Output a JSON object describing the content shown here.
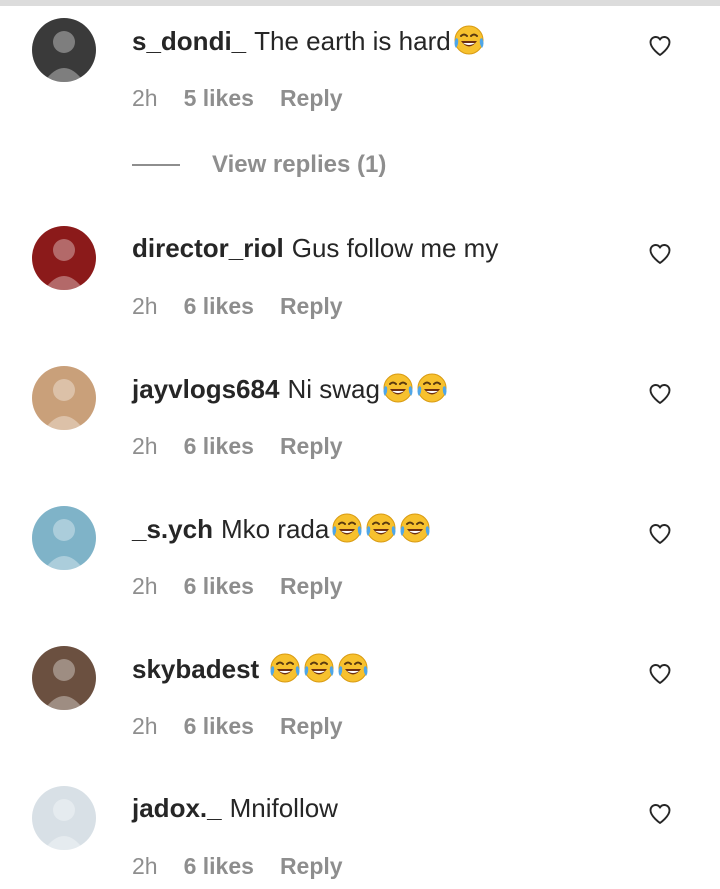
{
  "comments": [
    {
      "username": "s_dondi_",
      "text": "The earth is hard",
      "emoji_count": 1,
      "time": "2h",
      "likes": "5 likes",
      "reply": "Reply",
      "avatar_color": "#3a3a3a"
    },
    {
      "username": "director_riol",
      "text": "Gus follow me my",
      "emoji_count": 0,
      "time": "2h",
      "likes": "6 likes",
      "reply": "Reply",
      "avatar_color": "#8b1a1a"
    },
    {
      "username": "jayvlogs684",
      "text": "Ni swag",
      "emoji_count": 2,
      "time": "2h",
      "likes": "6 likes",
      "reply": "Reply",
      "avatar_color": "#c9a07a"
    },
    {
      "username": "_s.ych",
      "text": "Mko rada",
      "emoji_count": 3,
      "time": "2h",
      "likes": "6 likes",
      "reply": "Reply",
      "avatar_color": "#7fb3c8"
    },
    {
      "username": "skybadest",
      "text": "",
      "emoji_count": 3,
      "time": "2h",
      "likes": "6 likes",
      "reply": "Reply",
      "avatar_color": "#6b5040"
    },
    {
      "username": "jadox._",
      "text": "Mnifollow",
      "emoji_count": 0,
      "time": "2h",
      "likes": "6 likes",
      "reply": "Reply",
      "avatar_color": "#d8e0e6"
    }
  ],
  "view_replies": "View replies (1)",
  "icons": {
    "like": "heart-outline-icon",
    "emoji": "face-with-tears-of-joy-emoji"
  },
  "colors": {
    "username": "#262626",
    "meta": "#8e8e8e"
  }
}
